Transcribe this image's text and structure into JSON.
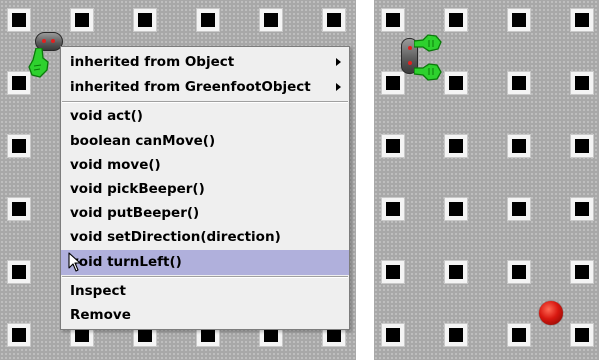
{
  "context_menu": {
    "items": [
      {
        "label": "inherited from Object",
        "has_submenu": true
      },
      {
        "label": "inherited from GreenfootObject",
        "has_submenu": true
      },
      {
        "label": "void act()"
      },
      {
        "label": "boolean canMove()"
      },
      {
        "label": "void move()"
      },
      {
        "label": "void pickBeeper()"
      },
      {
        "label": "void putBeeper()"
      },
      {
        "label": "void setDirection(direction)"
      },
      {
        "label": "void turnLeft()",
        "highlighted": true
      },
      {
        "label": "Inspect"
      },
      {
        "label": "Remove"
      }
    ]
  },
  "icons": {
    "robot": "robot-icon",
    "beeper": "beeper-icon",
    "cursor": "mouse-pointer-icon",
    "submenu": "submenu-arrow-icon"
  },
  "colors": {
    "world_background": "#a8a8a8",
    "post_square": "#000000",
    "menu_background": "#efefef",
    "menu_highlight": "#b0b0dc",
    "robot_hand": "#2ed12e",
    "beeper": "#d81810"
  }
}
